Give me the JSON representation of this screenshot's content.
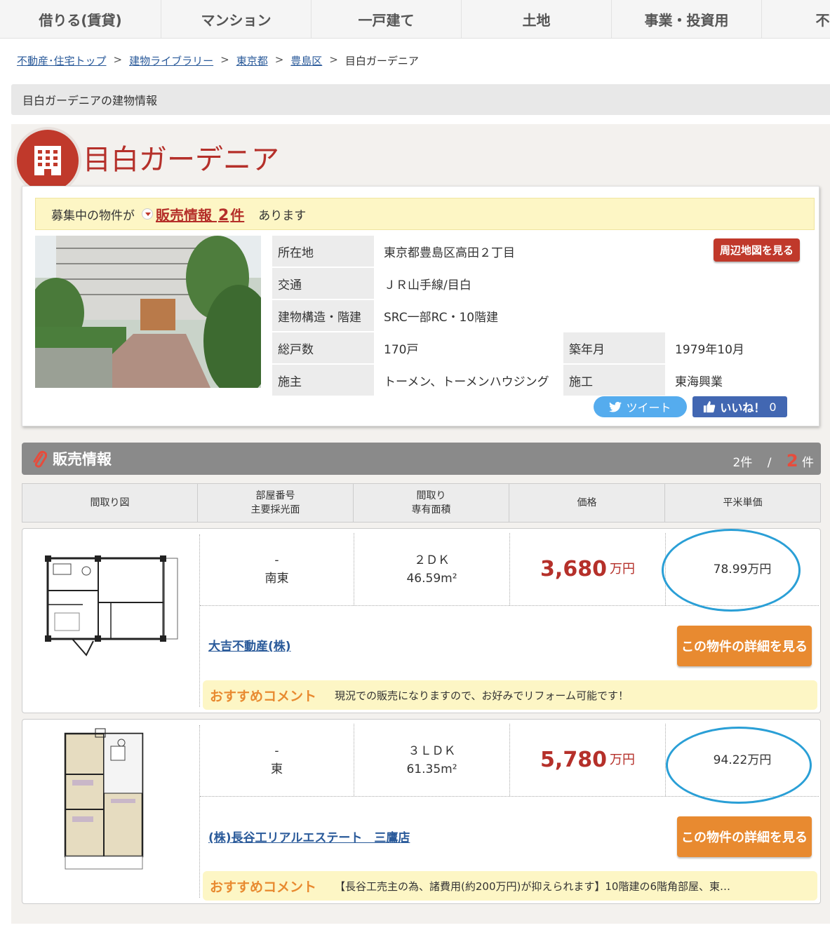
{
  "nav": [
    "借りる(賃貸)",
    "マンション",
    "一戸建て",
    "土地",
    "事業・投資用",
    "不動産"
  ],
  "breadcrumb": {
    "links": [
      "不動産･住宅トップ",
      "建物ライブラリー",
      "東京都",
      "豊島区"
    ],
    "current": "目白ガーデニア",
    "separator": ">"
  },
  "info_bar": "目白ガーデニアの建物情報",
  "building": {
    "name": "目白ガーデニア",
    "alert_prefix": "募集中の物件が",
    "alert_link": "販売情報",
    "alert_count": "2",
    "alert_unit": "件",
    "alert_suffix": "あります",
    "map_button": "周辺地図を見る",
    "specs": {
      "address_label": "所在地",
      "address": "東京都豊島区高田２丁目",
      "access_label": "交通",
      "access": "ＪＲ山手線/目白",
      "structure_label": "建物構造・階建",
      "structure": "SRC一部RC・10階建",
      "units_label": "総戸数",
      "units": "170戸",
      "built_label": "築年月",
      "built": "1979年10月",
      "owner_label": "施主",
      "owner": "トーメン、トーメンハウジング",
      "builder_label": "施工",
      "builder": "東海興業"
    },
    "tweet_label": "ツイート",
    "like_label": "いいね！",
    "like_count": "0"
  },
  "sales": {
    "title": "販売情報",
    "count_text": "2件",
    "slash": "/",
    "total": "2",
    "total_unit": "件",
    "headers": {
      "plan": "間取り図",
      "room_1": "部屋番号",
      "room_2": "主要採光面",
      "layout_1": "間取り",
      "layout_2": "専有面積",
      "price": "価格",
      "unit_price": "平米単価"
    },
    "detail_button": "この物件の詳細を見る",
    "comment_tag": "おすすめコメント",
    "listings": [
      {
        "room": "-",
        "facing": "南東",
        "layout": "２ＤＫ",
        "area": "46.59m²",
        "price": "3,680",
        "price_unit": "万円",
        "unit_price": "78.99万円",
        "agent": "大吉不動産(株)",
        "comment": "現況での販売になりますので、お好みでリフォーム可能です！"
      },
      {
        "room": "-",
        "facing": "東",
        "layout": "３ＬＤＫ",
        "area": "61.35m²",
        "price": "5,780",
        "price_unit": "万円",
        "unit_price": "94.22万円",
        "agent": "(株)長谷工リアルエステート　三鷹店",
        "comment": "【長谷工売主の為、諸費用(約200万円)が抑えられます】10階建の6階角部屋、東…"
      }
    ]
  },
  "colors": {
    "accent": "#b5302a",
    "orange": "#e88a30",
    "circle": "#2a9fd6"
  }
}
